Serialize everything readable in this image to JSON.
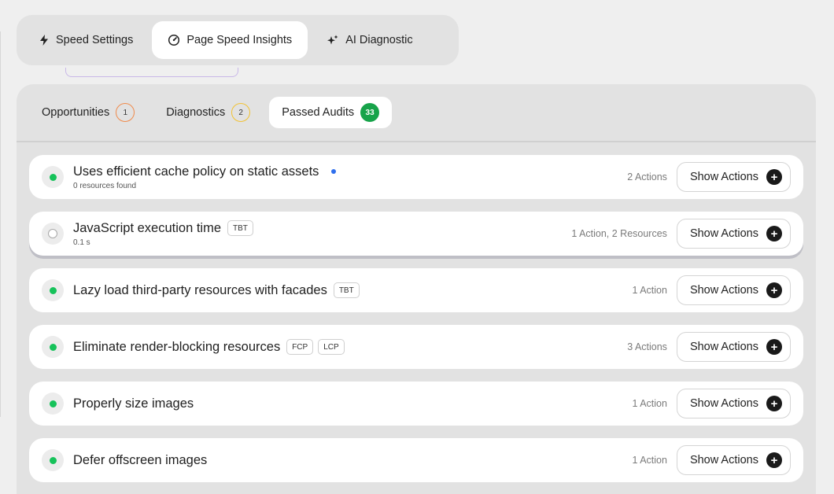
{
  "top_tabs": [
    {
      "label": "Speed Settings",
      "icon": "lightning-icon",
      "active": false
    },
    {
      "label": "Page Speed Insights",
      "icon": "gauge-icon",
      "active": true
    },
    {
      "label": "AI Diagnostic",
      "icon": "sparkle-icon",
      "active": false
    }
  ],
  "sub_tabs": [
    {
      "label": "Opportunities",
      "count": "1",
      "badge_color": "#f08a4b"
    },
    {
      "label": "Diagnostics",
      "count": "2",
      "badge_color": "#f2c232"
    },
    {
      "label": "Passed Audits",
      "count": "33",
      "badge_color": "#17a34a",
      "active": true
    }
  ],
  "audits": [
    {
      "title": "Uses efficient cache policy on static assets",
      "subtitle": "0 resources found",
      "status": "passed",
      "tags": [],
      "new_indicator": true,
      "count": "2 Actions",
      "button": "Show Actions"
    },
    {
      "title": "JavaScript execution time",
      "subtitle": "0.1 s",
      "status": "neutral",
      "tags": [
        "TBT"
      ],
      "count": "1 Action, 2 Resources",
      "button": "Show Actions"
    },
    {
      "title": "Lazy load third-party resources with facades",
      "subtitle": "",
      "status": "passed",
      "tags": [
        "TBT"
      ],
      "count": "1 Action",
      "button": "Show Actions"
    },
    {
      "title": "Eliminate render-blocking resources",
      "subtitle": "",
      "status": "passed",
      "tags": [
        "FCP",
        "LCP"
      ],
      "count": "3 Actions",
      "button": "Show Actions"
    },
    {
      "title": "Properly size images",
      "subtitle": "",
      "status": "passed",
      "tags": [],
      "count": "1 Action",
      "button": "Show Actions"
    },
    {
      "title": "Defer offscreen images",
      "subtitle": "",
      "status": "passed",
      "tags": [],
      "count": "1 Action",
      "button": "Show Actions"
    }
  ],
  "colors": {
    "passed": "#16c25a",
    "accent_blue": "#2f6fed",
    "badge_green": "#17a34a"
  }
}
